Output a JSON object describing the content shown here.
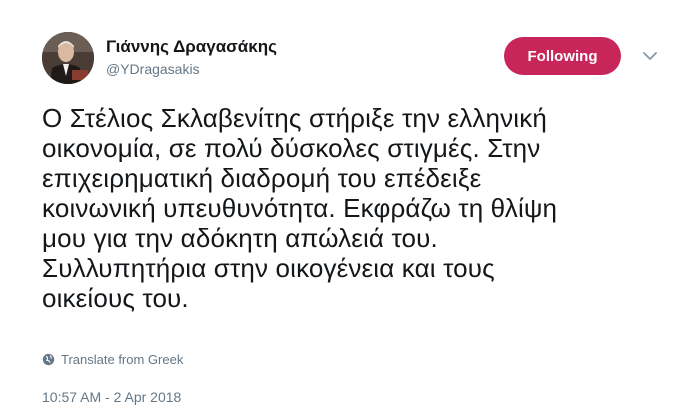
{
  "user": {
    "display_name": "Γιάννης Δραγασάκης",
    "handle": "@YDragasakis"
  },
  "follow_button": {
    "label": "Following",
    "color": "#c8265a"
  },
  "menu": {
    "icon": "chevron-down-icon"
  },
  "tweet": {
    "text": "Ο Στέλιος Σκλαβενίτης στήριξε την ελληνική\nοικονομία, σε πολύ δύσκολες στιγμές. Στην\nεπιχειρηματική διαδρομή του επέδειξε\nκοινωνική υπευθυνότητα. Εκφράζω τη θλίψη\nμου για την αδόκητη απώλειά του.\nΣυλλυπητήρια στην οικογένεια και τους\nοικείους του.",
    "translate_label": "Translate from Greek",
    "timestamp": "10:57 AM - 2 Apr 2018"
  },
  "icons": {
    "translate": "globe-icon",
    "avatar": "avatar"
  }
}
